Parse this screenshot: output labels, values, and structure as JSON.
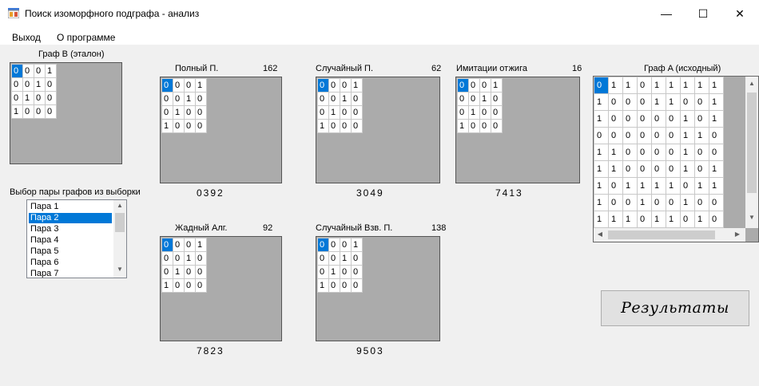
{
  "window": {
    "title": "Поиск изоморфного подграфа - анализ"
  },
  "controls": {
    "minimize": "—",
    "maximize": "☐",
    "close": "✕"
  },
  "menu": {
    "exit": "Выход",
    "about": "О программе"
  },
  "graphB": {
    "label": "Граф B (эталон)"
  },
  "pair_select": {
    "label": "Выбор пары графов из выборки",
    "items": [
      "Пара 1",
      "Пара 2",
      "Пара 3",
      "Пара 4",
      "Пара 5",
      "Пара 6",
      "Пара 7"
    ],
    "selected": "Пара 2"
  },
  "matrix": [
    [
      0,
      0,
      0,
      1
    ],
    [
      0,
      0,
      1,
      0
    ],
    [
      0,
      1,
      0,
      0
    ],
    [
      1,
      0,
      0,
      0
    ]
  ],
  "methods": {
    "full": {
      "label": "Полный П.",
      "count": "162",
      "code": "0392"
    },
    "random": {
      "label": "Случайный П.",
      "count": "62",
      "code": "3049"
    },
    "annealing": {
      "label": "Имитации отжига",
      "count": "16",
      "code": "7413"
    },
    "greedy": {
      "label": "Жадный Алг.",
      "count": "92",
      "code": "7823"
    },
    "weighted": {
      "label": "Случайный Взв. П.",
      "count": "138",
      "code": "9503"
    }
  },
  "graphA": {
    "label": "Граф A (исходный)",
    "rows": [
      [
        0,
        1,
        1,
        0,
        1,
        1,
        1,
        1,
        1
      ],
      [
        1,
        0,
        0,
        0,
        1,
        1,
        0,
        0,
        1
      ],
      [
        1,
        0,
        0,
        0,
        0,
        0,
        1,
        0,
        1
      ],
      [
        0,
        0,
        0,
        0,
        0,
        0,
        1,
        1,
        0
      ],
      [
        1,
        1,
        0,
        0,
        0,
        0,
        1,
        0,
        0
      ],
      [
        1,
        1,
        0,
        0,
        0,
        0,
        1,
        0,
        1
      ],
      [
        1,
        0,
        1,
        1,
        1,
        1,
        0,
        1,
        1
      ],
      [
        1,
        0,
        0,
        1,
        0,
        0,
        1,
        0,
        0
      ],
      [
        1,
        1,
        1,
        0,
        1,
        1,
        0,
        1,
        0
      ]
    ]
  },
  "results_button": "Результаты"
}
